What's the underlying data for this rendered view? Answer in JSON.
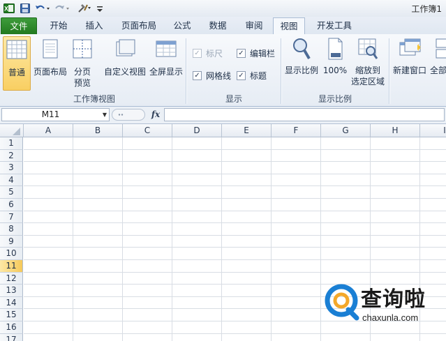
{
  "window": {
    "title": "工作簿1"
  },
  "tabs": [
    {
      "label": "文件",
      "type": "file"
    },
    {
      "label": "开始"
    },
    {
      "label": "插入"
    },
    {
      "label": "页面布局"
    },
    {
      "label": "公式"
    },
    {
      "label": "数据"
    },
    {
      "label": "审阅"
    },
    {
      "label": "视图",
      "active": true
    },
    {
      "label": "开发工具"
    }
  ],
  "ribbon": {
    "workbook_views": {
      "label": "工作簿视图",
      "normal": "普通",
      "page_layout": "页面布局",
      "page_break_line1": "分页",
      "page_break_line2": "预览",
      "custom_views": "自定义视图",
      "full_screen": "全屏显示"
    },
    "show": {
      "label": "显示",
      "ruler": "标尺",
      "formula_bar": "编辑栏",
      "gridlines": "网格线",
      "headings": "标题"
    },
    "zoom": {
      "label": "显示比例",
      "zoom": "显示比例",
      "hundred": "100%",
      "zoom_sel_line1": "缩放到",
      "zoom_sel_line2": "选定区域"
    },
    "window": {
      "new_window": "新建窗口",
      "arrange_all_partial": "全部"
    }
  },
  "formula_bar": {
    "name_box": "M11",
    "fx": "fx",
    "content": ""
  },
  "grid": {
    "columns": [
      "A",
      "B",
      "C",
      "D",
      "E",
      "F",
      "G",
      "H",
      "I"
    ],
    "rows": [
      "1",
      "2",
      "3",
      "4",
      "5",
      "6",
      "7",
      "8",
      "9",
      "10",
      "11",
      "12",
      "13",
      "14",
      "15",
      "16",
      "17"
    ],
    "selected_row": "11"
  },
  "watermark": {
    "title": "查询啦",
    "url": "chaxunla.com"
  },
  "colors": {
    "file_tab": "#2e8b2b",
    "accent": "#f9cf62",
    "watermark": "#1a7fd4"
  }
}
